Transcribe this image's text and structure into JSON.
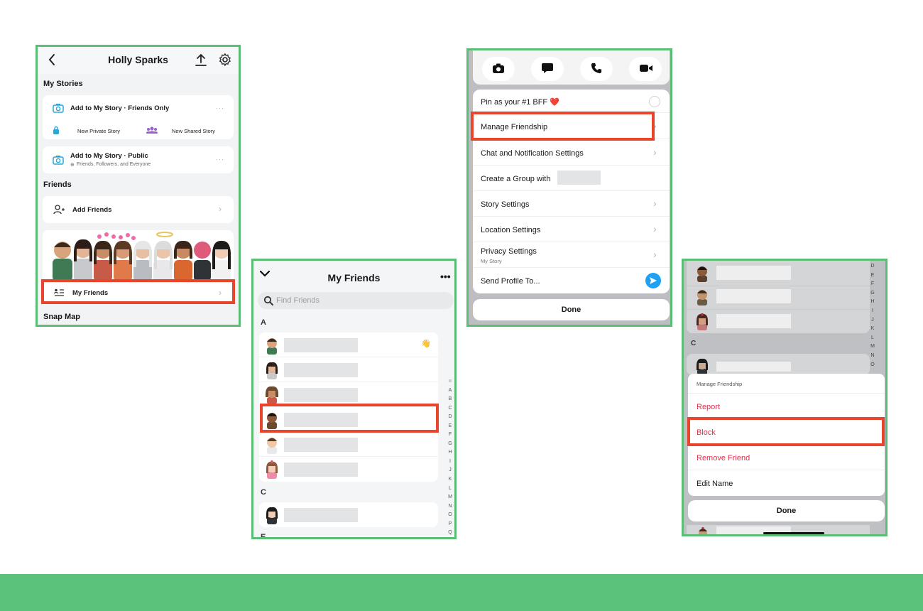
{
  "panel1": {
    "title": "Holly Sparks",
    "my_stories_heading": "My Stories",
    "story_friends_only": "Add to My Story · Friends Only",
    "new_private_story": "New Private Story",
    "new_shared_story": "New Shared Story",
    "story_public": "Add to My Story · Public",
    "story_public_sub": "Friends, Followers, and Everyone",
    "friends_heading": "Friends",
    "add_friends": "Add Friends",
    "my_friends": "My Friends",
    "snap_map_heading": "Snap Map",
    "more_glyph": "···",
    "chevron": "›"
  },
  "panel2": {
    "title": "My Friends",
    "more_glyph": "•••",
    "search_placeholder": "Find Friends",
    "section_a": "A",
    "section_c": "C",
    "section_e": "E",
    "alphabet": [
      "☺",
      "A",
      "B",
      "C",
      "D",
      "E",
      "F",
      "G",
      "H",
      "I",
      "J",
      "K",
      "L",
      "M",
      "N",
      "O",
      "P",
      "Q"
    ]
  },
  "panel3": {
    "pin_bff": "Pin as your #1 BFF ❤️",
    "manage_friendship": "Manage Friendship",
    "chat_settings": "Chat and Notification Settings",
    "create_group": "Create a Group with",
    "story_settings": "Story Settings",
    "location_settings": "Location Settings",
    "privacy_settings": "Privacy Settings",
    "privacy_sub": "My Story",
    "send_profile": "Send Profile To...",
    "done": "Done",
    "chevron": "›"
  },
  "panel4": {
    "alphabet": [
      "D",
      "E",
      "F",
      "G",
      "H",
      "I",
      "J",
      "K",
      "L",
      "M",
      "N",
      "O"
    ],
    "section_c": "C",
    "sheet_title": "Manage Friendship",
    "report": "Report",
    "block": "Block",
    "remove_friend": "Remove Friend",
    "edit_name": "Edit Name",
    "done": "Done"
  },
  "colors": {
    "highlight_red": "#e8452c",
    "panel_border_green": "#5cbd74",
    "bottom_band_green": "#5ac27a",
    "snap_blue": "#1ea1f2",
    "destructive_red": "#d9314b"
  }
}
